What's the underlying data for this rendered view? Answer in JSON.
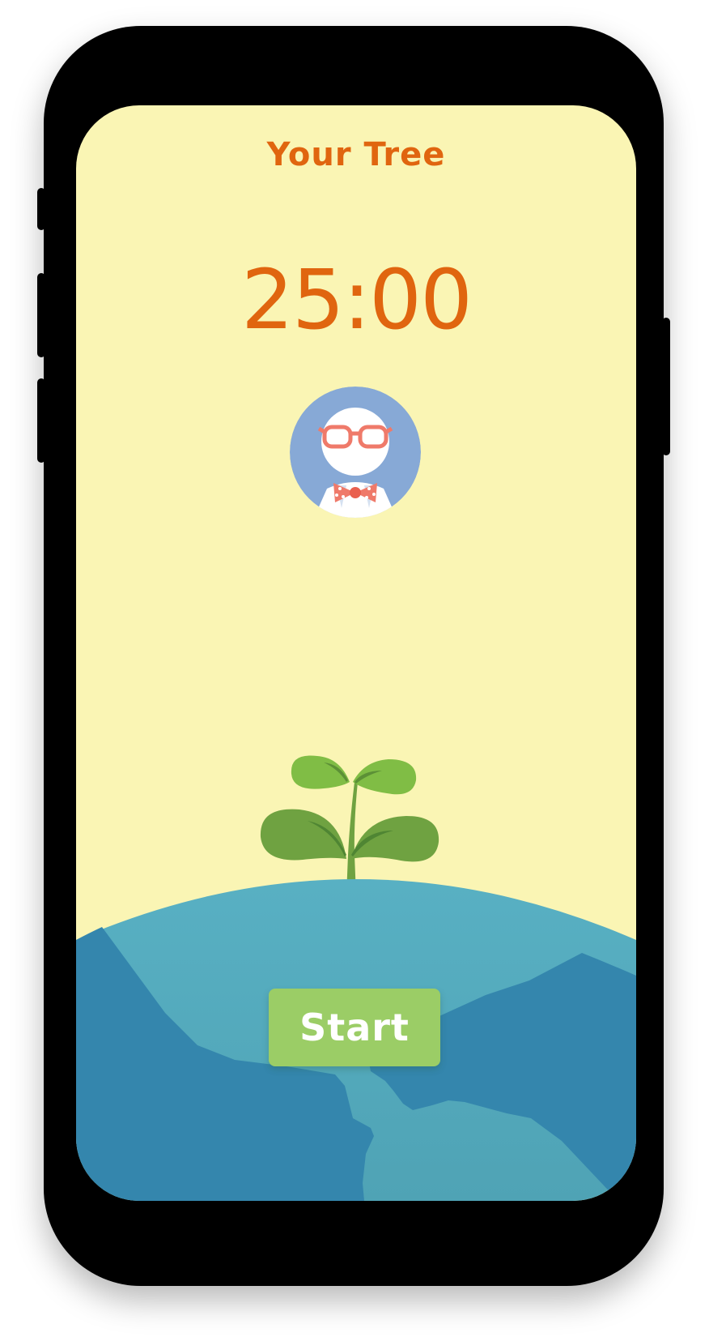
{
  "screen": {
    "title": "Your Tree",
    "timer": "25:00",
    "start_label": "Start"
  },
  "icons": {
    "avatar": "nerd-avatar-icon",
    "plant": "sprout-icon",
    "globe": "earth-illustration"
  },
  "colors": {
    "background": "#faf5b4",
    "accent_text": "#e0650f",
    "button": "#9bcd66",
    "avatar_bg": "#87a9d6",
    "ocean_light": "#5aafc2",
    "ocean_dark": "#3486ad",
    "leaf_light": "#80bd45",
    "leaf_dark": "#6fa241"
  }
}
